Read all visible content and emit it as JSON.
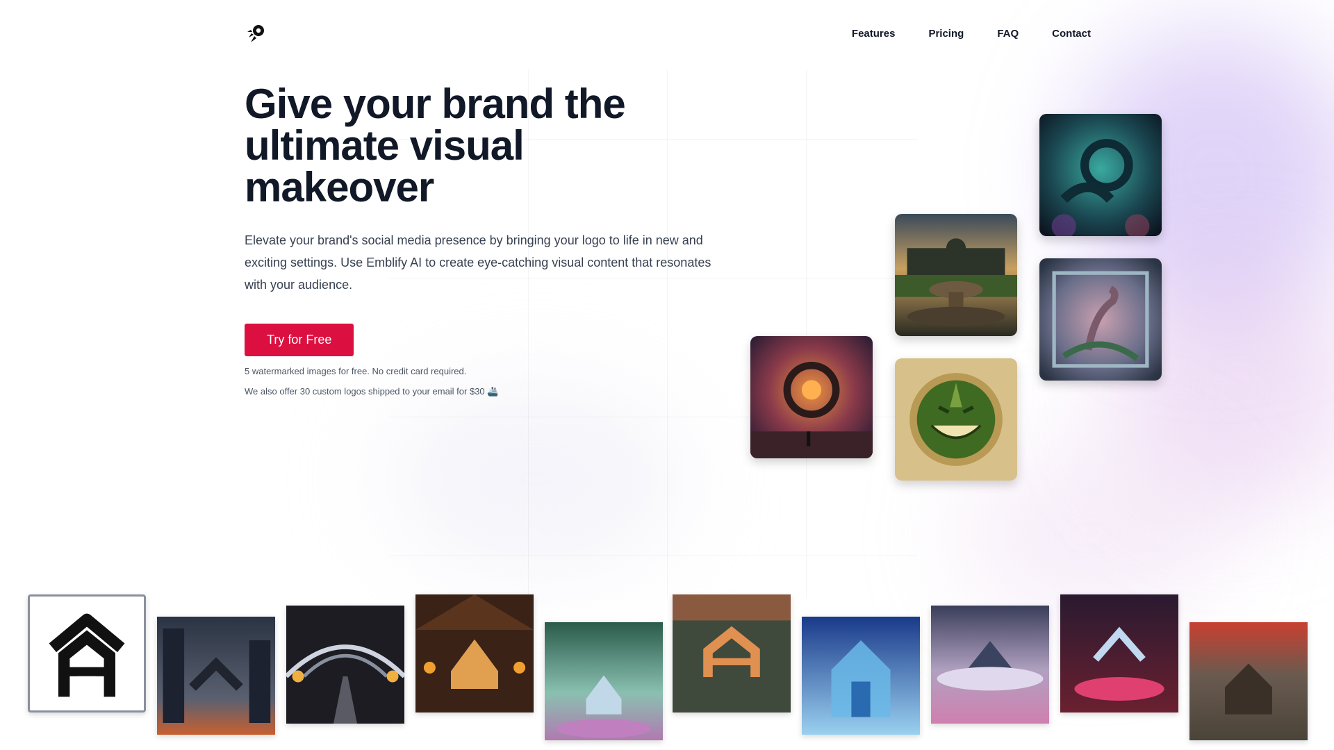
{
  "header": {
    "logo": "rocket-logo-icon",
    "nav": [
      "Features",
      "Pricing",
      "FAQ",
      "Contact"
    ]
  },
  "hero": {
    "title": "Give your brand the ultimate visual makeover",
    "description": "Elevate your brand's social media presence by bringing your logo to life in new and exciting settings. Use Emblify AI to create eye-catching visual content that resonates with your audience.",
    "cta_label": "Try for Free",
    "note_free": "5 watermarked images for free. No credit card required.",
    "note_offer": "We also offer 30 custom logos shipped to your email for $30 🚢"
  },
  "gallery": {
    "images": [
      "cosmic-bird-image",
      "palace-fountain-image",
      "misty-kangaroo-image",
      "glowing-portal-image",
      "green-smile-medallion-image"
    ]
  },
  "strip": {
    "selected": "house-logo-original",
    "items": [
      "house-logo-original",
      "cyber-city-image",
      "neon-tunnel-image",
      "wooden-cabin-image",
      "forest-shrine-image",
      "aerial-town-image",
      "ice-temple-image",
      "cloud-peak-image",
      "arena-stage-image",
      "mountain-hut-image"
    ]
  },
  "colors": {
    "accent": "#dc1040",
    "text": "#111827",
    "muted": "#4b5563"
  }
}
